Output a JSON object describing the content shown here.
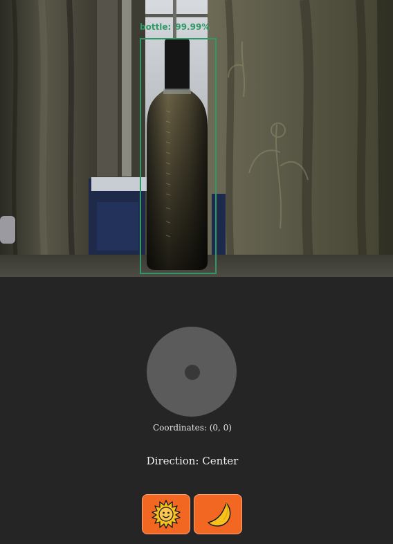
{
  "camera": {
    "detection": {
      "label": "bottle:",
      "confidence": "99.99%",
      "color": "#2f9a66"
    }
  },
  "joystick": {
    "coordinates_text": "Coordinates: (0, 0)",
    "direction_text": "Direction: Center"
  },
  "theme_buttons": [
    {
      "icon": "sun-icon"
    },
    {
      "icon": "moon-icon"
    }
  ],
  "colors": {
    "background": "#252525",
    "button": "#f26722",
    "joystick": "#5b5b5b"
  }
}
